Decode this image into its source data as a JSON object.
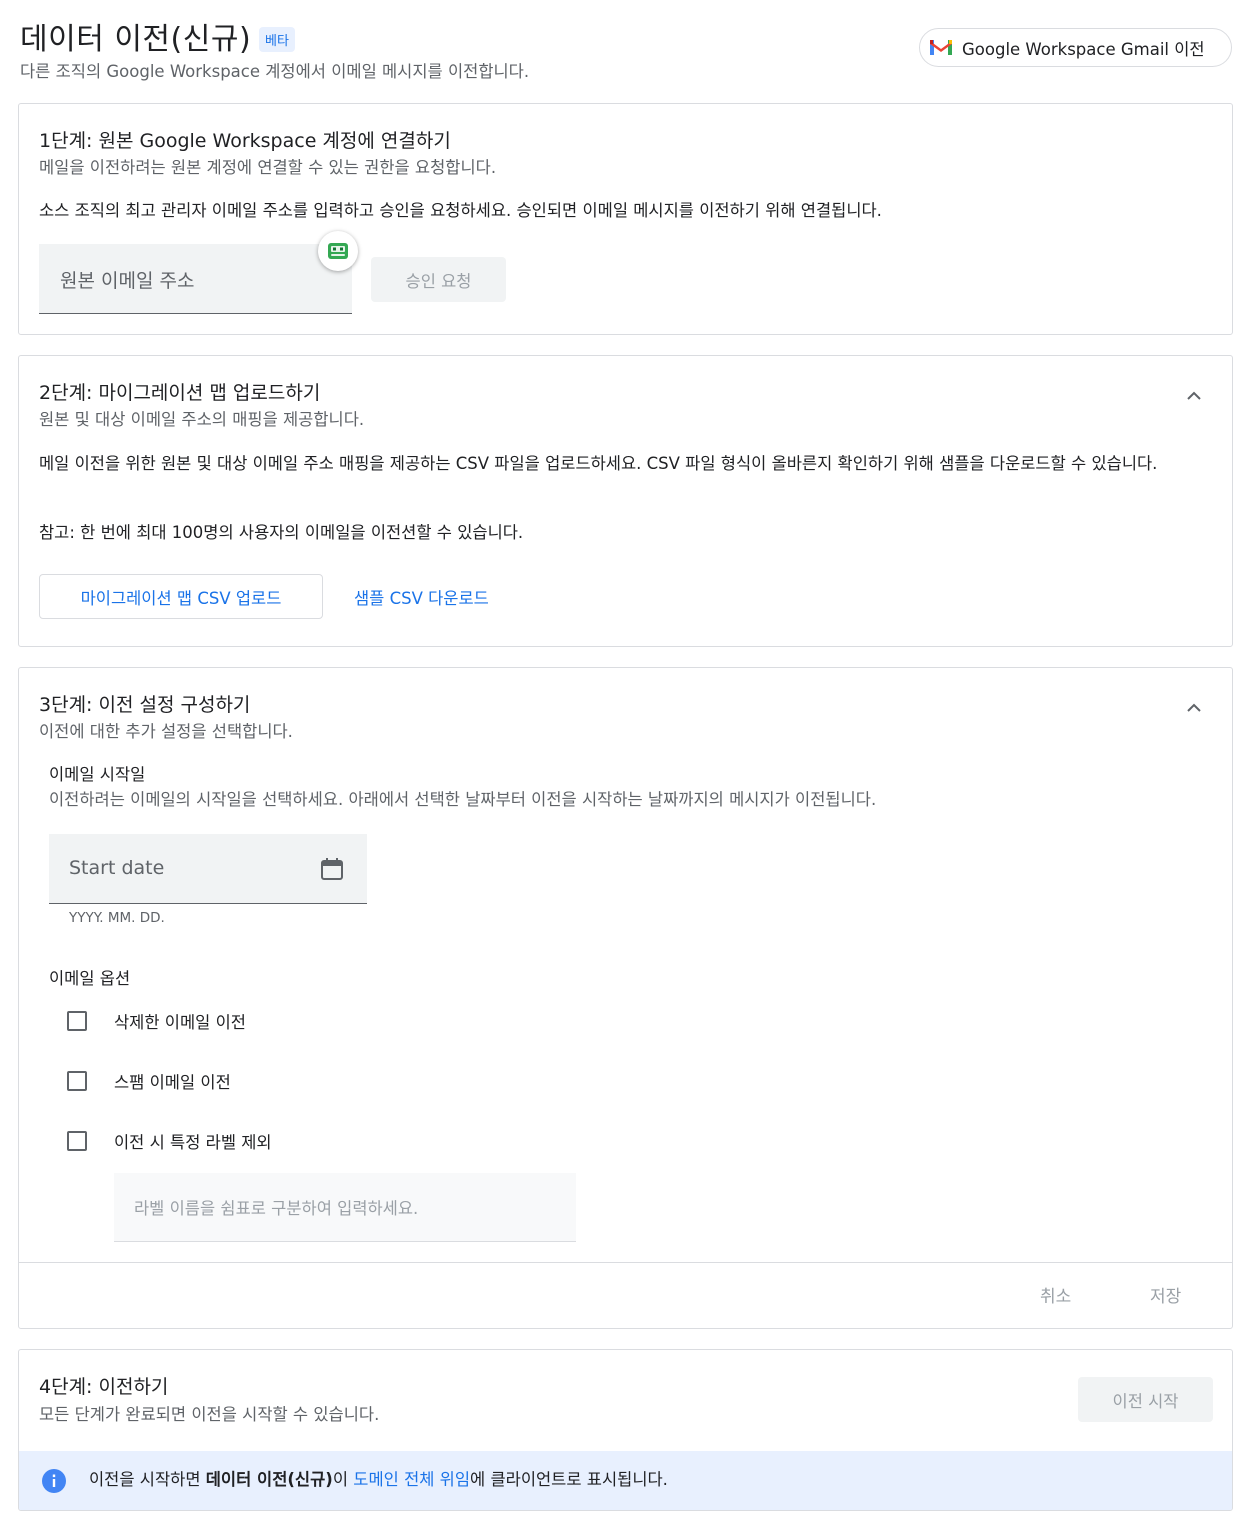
{
  "header": {
    "title": "데이터 이전(신규)",
    "beta_badge": "베타",
    "subtitle": "다른 조직의 Google Workspace 계정에서 이메일 메시지를 이전합니다.",
    "gmail_button_label": "Google Workspace Gmail 이전"
  },
  "step1": {
    "title": "1단계: 원본 Google Workspace 계정에 연결하기",
    "subtitle": "메일을 이전하려는 원본 계정에 연결할 수 있는 권한을 요청합니다.",
    "description": "소스 조직의 최고 관리자 이메일 주소를 입력하고 승인을 요청하세요. 승인되면 이메일 메시지를 이전하기 위해 연결됩니다.",
    "email_placeholder": "원본 이메일 주소",
    "request_button": "승인 요청"
  },
  "step2": {
    "title": "2단계: 마이그레이션 맵 업로드하기",
    "subtitle": "원본 및 대상 이메일 주소의 매핑을 제공합니다.",
    "description": "메일 이전을 위한 원본 및 대상 이메일 주소 매핑을 제공하는 CSV 파일을 업로드하세요. CSV 파일 형식이 올바른지 확인하기 위해 샘플을 다운로드할 수 있습니다.",
    "note": "참고: 한 번에 최대 100명의 사용자의 이메일을 이전션할 수 있습니다.",
    "upload_button": "마이그레이션 맵 CSV 업로드",
    "sample_link": "샘플 CSV 다운로드"
  },
  "step3": {
    "title": "3단계: 이전 설정 구성하기",
    "subtitle": "이전에 대한 추가 설정을 선택합니다.",
    "start_date_heading": "이메일 시작일",
    "start_date_desc": "이전하려는 이메일의 시작일을 선택하세요. 아래에서 선택한 날짜부터 이전을 시작하는 날짜까지의 메시지가 이전됩니다.",
    "start_date_placeholder": "Start date",
    "date_format_hint": "YYYY. MM. DD.",
    "email_options_heading": "이메일 옵션",
    "options": [
      {
        "label": "삭제한 이메일 이전",
        "checked": false
      },
      {
        "label": "스팸 이메일 이전",
        "checked": false
      },
      {
        "label": "이전 시 특정 라벨 제외",
        "checked": false
      }
    ],
    "labels_placeholder": "라벨 이름을 쉼표로 구분하여 입력하세요.",
    "cancel_button": "취소",
    "save_button": "저장"
  },
  "step4": {
    "title": "4단계: 이전하기",
    "subtitle": "모든 단계가 완료되면 이전을 시작할 수 있습니다.",
    "start_button": "이전 시작",
    "info_prefix": "이전을 시작하면 ",
    "info_bold": "데이터 이전(신규)",
    "info_middle": "이 ",
    "info_link": "도메인 전체 위임",
    "info_suffix": "에 클라이언트로 표시됩니다."
  },
  "colors": {
    "accent": "#1a73e8",
    "info_banner_bg": "#e8f0fe",
    "disabled_bg": "#f1f3f4",
    "bitwarden_green": "#34a853"
  },
  "icons": [
    "gmail-logo-icon",
    "password-manager-icon",
    "chevron-up-icon",
    "calendar-icon",
    "info-icon"
  ]
}
